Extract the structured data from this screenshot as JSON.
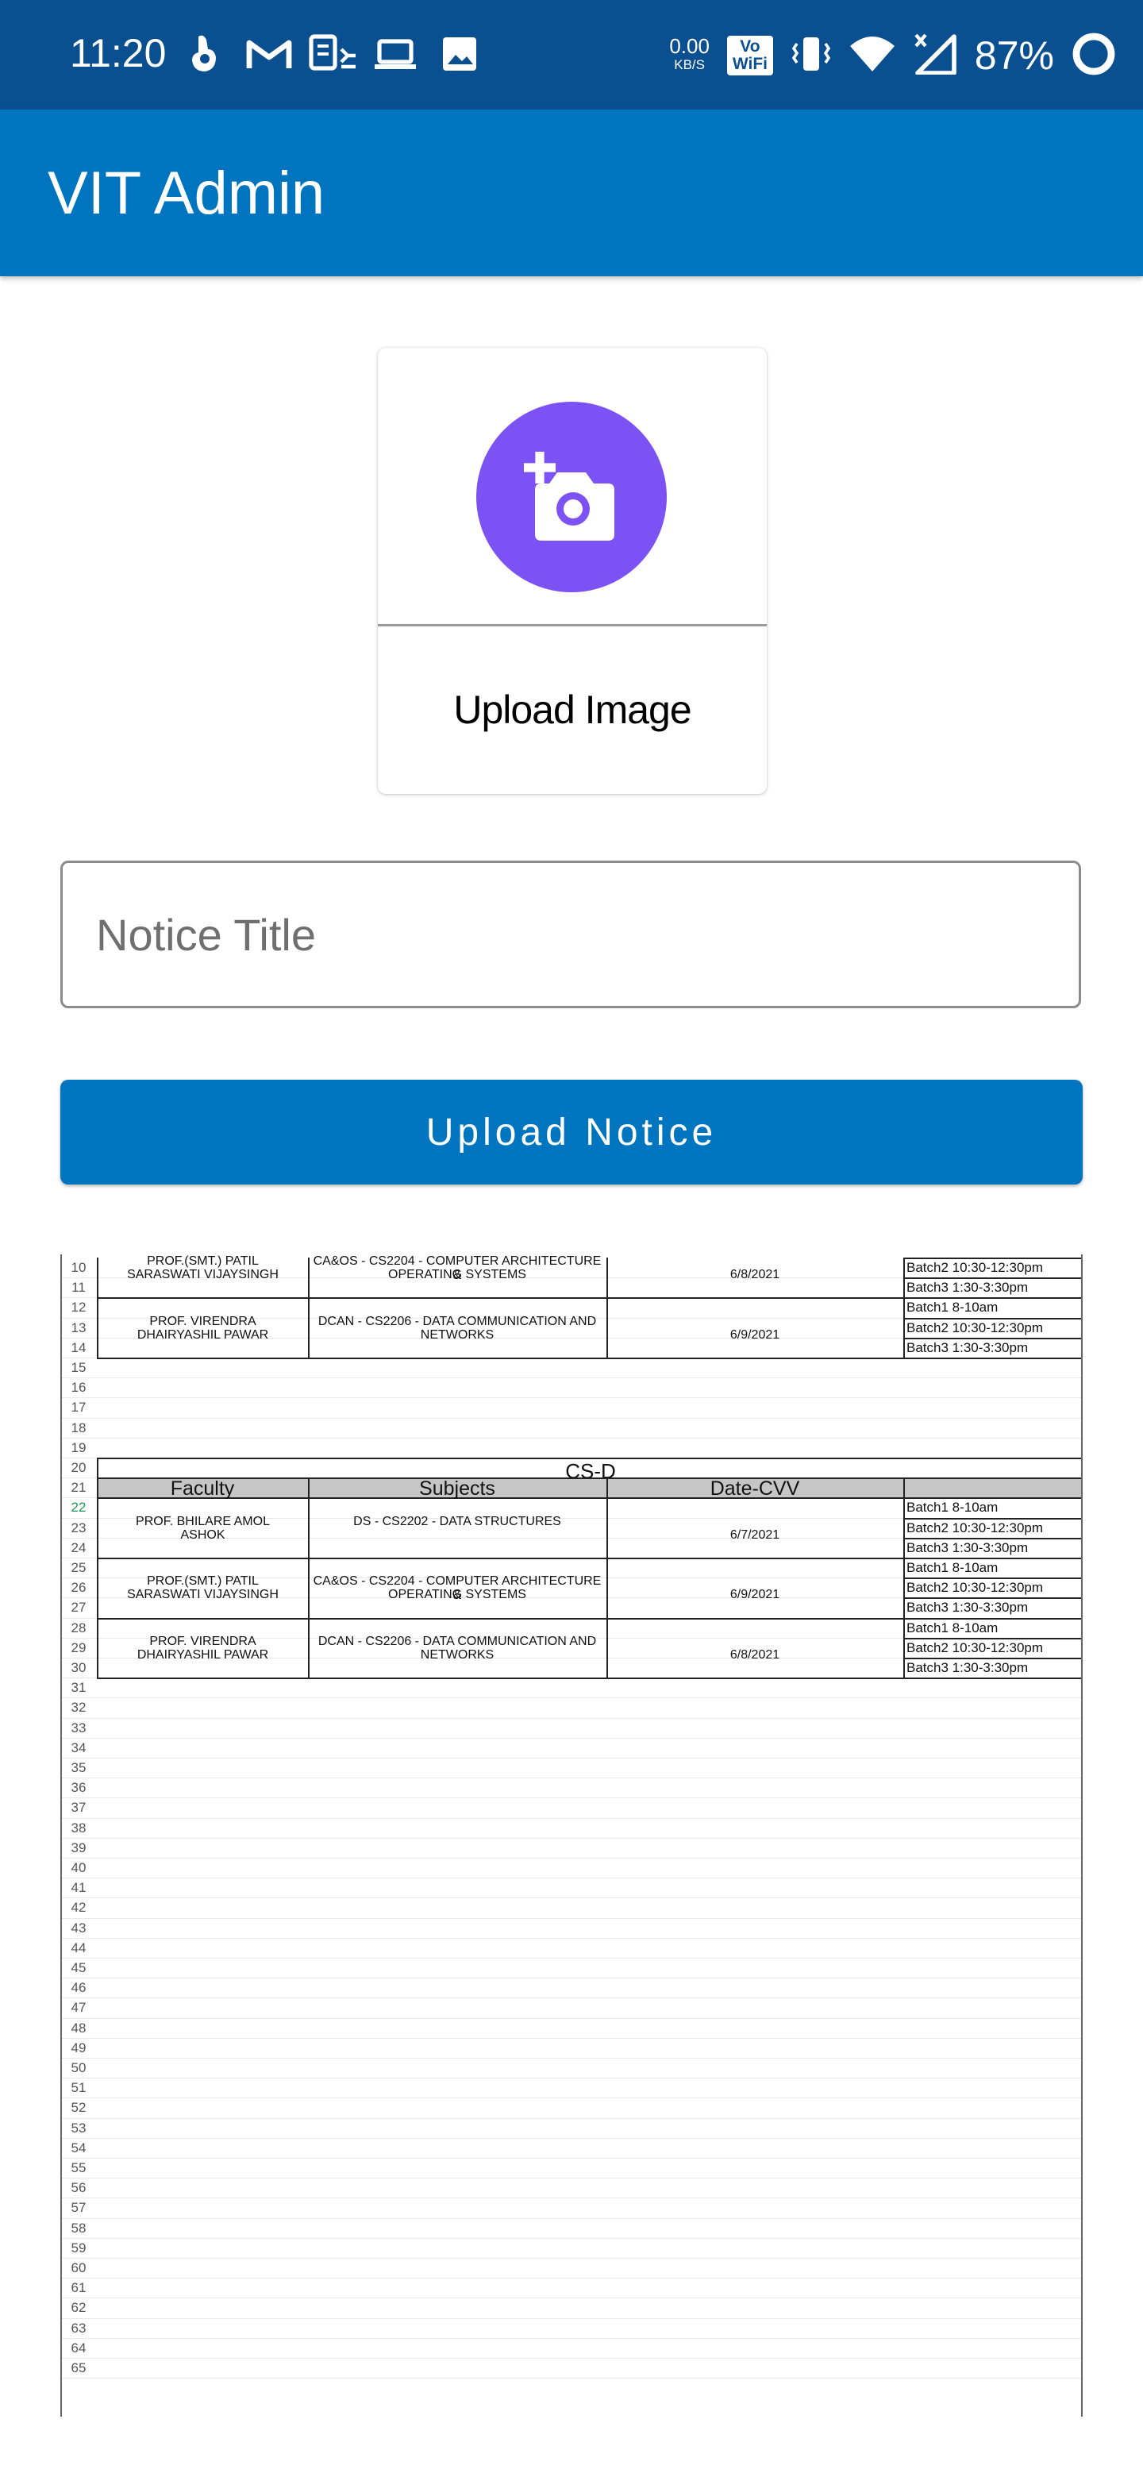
{
  "status_bar": {
    "time": "11:20",
    "net_speed_value": "0.00",
    "net_speed_unit": "KB/S",
    "vowifi_line1": "Vo",
    "vowifi_line2": "WiFi",
    "battery": "87%",
    "icons": [
      "hand-icon",
      "gmail-icon",
      "device-icon",
      "laptop-icon",
      "image-icon",
      "vibrate-icon",
      "wifi-icon",
      "signal-icon",
      "battery-ring-icon"
    ]
  },
  "app_bar": {
    "title": "VIT Admin"
  },
  "upload_card": {
    "label": "Upload Image",
    "icon": "add-photo-icon"
  },
  "notice_title": {
    "placeholder": "Notice Title",
    "value": ""
  },
  "upload_button": {
    "label": "Upload Notice"
  },
  "colors": {
    "status_bar": "#0a4f8f",
    "app_bar": "#0075bf",
    "primary_button": "#0075bf",
    "camera_circle": "#7c52f4"
  },
  "preview": {
    "row_numbers": [
      "10",
      "11",
      "12",
      "13",
      "14",
      "15",
      "16",
      "17",
      "18",
      "19",
      "20",
      "21",
      "22",
      "23",
      "24",
      "25",
      "26",
      "27",
      "28",
      "29",
      "30",
      "31",
      "32",
      "33",
      "34",
      "35",
      "36",
      "37",
      "38",
      "39",
      "40",
      "41",
      "42",
      "43",
      "44",
      "45",
      "46",
      "47",
      "48",
      "49",
      "50",
      "51",
      "52",
      "53",
      "54",
      "55",
      "56",
      "57",
      "58",
      "59",
      "60",
      "61",
      "62",
      "63",
      "64",
      "65"
    ],
    "top_block": [
      {
        "faculty_line1": "PROF.(SMT.) PATIL",
        "faculty_line2": "SARASWATI VIJAYSINGH",
        "subject_line1": "CA&OS - CS2204 - COMPUTER ARCHITECTURE &",
        "subject_line2": "OPERATING SYSTEMS",
        "date": "6/8/2021",
        "batches": [
          "Batch2 10:30-12:30pm",
          "Batch3 1:30-3:30pm"
        ]
      },
      {
        "faculty_line1": "PROF. VIRENDRA",
        "faculty_line2": "DHAIRYASHIL PAWAR",
        "subject_line1": "DCAN - CS2206 - DATA COMMUNICATION AND",
        "subject_line2": "NETWORKS",
        "date": "6/9/2021",
        "batches": [
          "Batch1  8-10am",
          "Batch2 10:30-12:30pm",
          "Batch3 1:30-3:30pm"
        ]
      }
    ],
    "section_title": "CS-D",
    "headers": [
      "Faculty",
      "Subjects",
      "Date-CVV",
      ""
    ],
    "section_rows": [
      {
        "faculty_line1": "PROF. BHILARE AMOL",
        "faculty_line2": "ASHOK",
        "subject_line1": "DS - CS2202 - DATA STRUCTURES",
        "subject_line2": "",
        "date": "6/7/2021",
        "batches": [
          "Batch1  8-10am",
          "Batch2 10:30-12:30pm",
          "Batch3 1:30-3:30pm"
        ]
      },
      {
        "faculty_line1": "PROF.(SMT.) PATIL",
        "faculty_line2": "SARASWATI VIJAYSINGH",
        "subject_line1": "CA&OS - CS2204 - COMPUTER ARCHITECTURE &",
        "subject_line2": "OPERATING SYSTEMS",
        "date": "6/9/2021",
        "batches": [
          "Batch1  8-10am",
          "Batch2 10:30-12:30pm",
          "Batch3 1:30-3:30pm"
        ]
      },
      {
        "faculty_line1": "PROF. VIRENDRA",
        "faculty_line2": "DHAIRYASHIL PAWAR",
        "subject_line1": "DCAN - CS2206 - DATA COMMUNICATION AND",
        "subject_line2": "NETWORKS",
        "date": "6/8/2021",
        "batches": [
          "Batch1  8-10am",
          "Batch2 10:30-12:30pm",
          "Batch3 1:30-3:30pm"
        ]
      }
    ]
  }
}
